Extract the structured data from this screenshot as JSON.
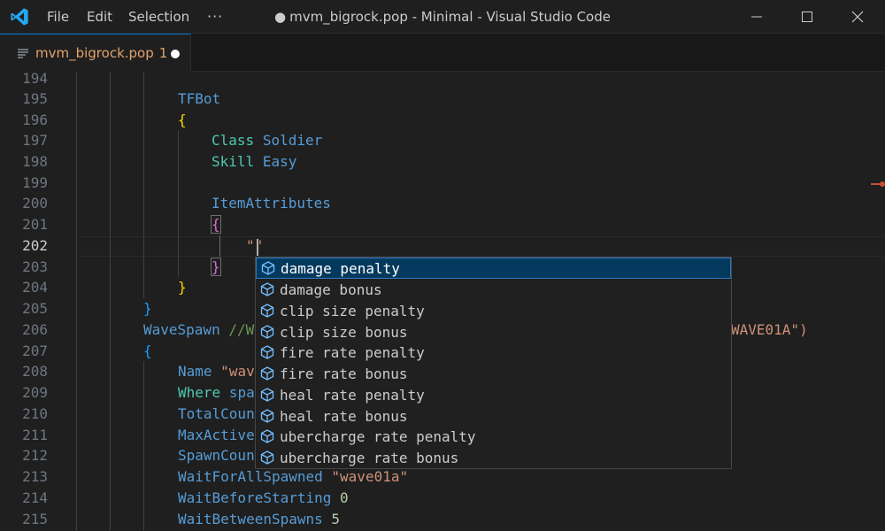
{
  "titlebar": {
    "menu": [
      "File",
      "Edit",
      "Selection",
      "···"
    ],
    "title": "mvm_bigrock.pop - Minimal - Visual Studio Code",
    "dirty_dot": "●"
  },
  "tab": {
    "filename": "mvm_bigrock.pop",
    "problems": "1",
    "icon": "lines-icon"
  },
  "editor": {
    "active_line": 202,
    "line_numbers": [
      "194",
      "195",
      "196",
      "197",
      "198",
      "199",
      "200",
      "201",
      "202",
      "203",
      "204",
      "205",
      "206",
      "207",
      "208",
      "209",
      "210",
      "211",
      "212",
      "213",
      "214",
      "215"
    ],
    "lines": {
      "l195": "TFBot",
      "l196": "{",
      "l197_k": "Class",
      "l197_v": "Soldier",
      "l198_k": "Skill",
      "l198_v": "Easy",
      "l200": "ItemAttributes",
      "l201": "{",
      "l202": "\"\"",
      "l203": "}",
      "l204": "}",
      "l205": "}",
      "l206_k": "WaveSpawn",
      "l206_c": "//W",
      "l206_r": "WAVE01A\")",
      "l207": "{",
      "l208_k": "Name",
      "l208_s": "\"wav",
      "l209_k": "Where",
      "l209_v": "spa",
      "l210": "TotalCoun",
      "l211": "MaxActive",
      "l212": "SpawnCoun",
      "l213_k": "WaitForAllSpawned",
      "l213_s": "\"wave01a\"",
      "l214_k": "WaitBeforeStarting",
      "l214_n": "0",
      "l215_k": "WaitBetweenSpawns",
      "l215_n": "5"
    }
  },
  "suggestions": [
    "damage penalty",
    "damage bonus",
    "clip size penalty",
    "clip size bonus",
    "fire rate penalty",
    "fire rate bonus",
    "heal rate penalty",
    "heal rate bonus",
    "ubercharge rate penalty",
    "ubercharge rate bonus"
  ],
  "suggestion_icon": "cube-icon",
  "colors": {
    "accent": "#0078d4",
    "focused_suggestion": "#04395e",
    "tab_label": "#e2a36b"
  }
}
